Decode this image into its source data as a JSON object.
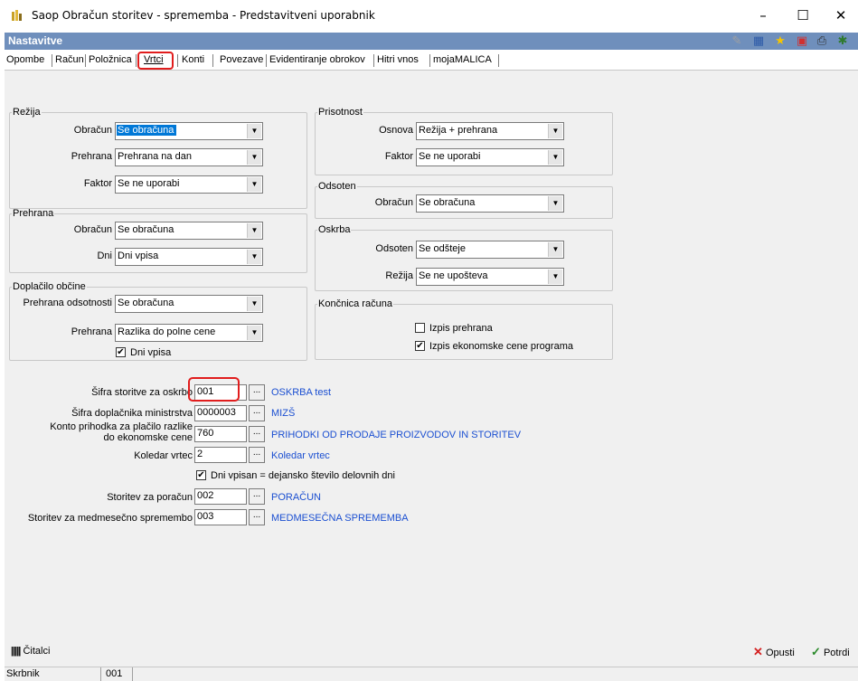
{
  "window": {
    "title": "Saop Obračun storitev - sprememba - Predstavitveni uporabnik",
    "minimize": "–",
    "maximize": "☐",
    "close": "✕"
  },
  "header": {
    "title": "Nastavitve",
    "icons": [
      "edit-icon",
      "grid-icon",
      "star-icon",
      "export-icon",
      "print-icon",
      "run-icon"
    ]
  },
  "tabs": [
    {
      "label": "Opombe"
    },
    {
      "label": "Račun"
    },
    {
      "label": "Položnica"
    },
    {
      "label": "Vrtci",
      "active": true
    },
    {
      "label": "Konti"
    },
    {
      "label": "Povezave"
    },
    {
      "label": "Evidentiranje obrokov"
    },
    {
      "label": "Hitri vnos"
    },
    {
      "label": "mojaMALICA"
    }
  ],
  "rezija": {
    "legend": "Režija",
    "obracun_label": "Obračun",
    "obracun_value": "Se obračuna",
    "prehrana_label": "Prehrana",
    "prehrana_value": "Prehrana na dan",
    "faktor_label": "Faktor",
    "faktor_value": "Se ne uporabi"
  },
  "prehrana": {
    "legend": "Prehrana",
    "obracun_label": "Obračun",
    "obracun_value": "Se obračuna",
    "dni_label": "Dni",
    "dni_value": "Dni vpisa"
  },
  "doplacilo": {
    "legend": "Doplačilo občine",
    "odsotnosti_label": "Prehrana odsotnosti",
    "odsotnosti_value": "Se obračuna",
    "prehrana_label": "Prehrana",
    "prehrana_value": "Razlika do polne cene",
    "dni_vpisa_label": "Dni vpisa",
    "dni_vpisa_checked": true
  },
  "prisotnost": {
    "legend": "Prisotnost",
    "osnova_label": "Osnova",
    "osnova_value": "Režija + prehrana",
    "faktor_label": "Faktor",
    "faktor_value": "Se ne uporabi"
  },
  "odsoten": {
    "legend": "Odsoten",
    "obracun_label": "Obračun",
    "obracun_value": "Se obračuna"
  },
  "oskrba": {
    "legend": "Oskrba",
    "odsoten_label": "Odsoten",
    "odsoten_value": "Se odšteje",
    "rezija_label": "Režija",
    "rezija_value": "Se ne upošteva"
  },
  "koncnica": {
    "legend": "Končnica računa",
    "izpis_prehrana_label": "Izpis prehrana",
    "izpis_prehrana_checked": false,
    "izpis_ekonomske_label": "Izpis ekonomske cene programa",
    "izpis_ekonomske_checked": true
  },
  "fields": {
    "sifra_storitve_label": "Šifra storitve za oskrbo",
    "sifra_storitve_value": "001",
    "sifra_storitve_desc": "OSKRBA test",
    "sifra_doplacnika_label": "Šifra doplačnika ministrstva",
    "sifra_doplacnika_value": "0000003",
    "sifra_doplacnika_desc": "MIZŠ",
    "konto_label_1": "Konto prihodka za plačilo razlike",
    "konto_label_2": "do ekonomske cene",
    "konto_value": "760",
    "konto_desc": "PRIHODKI OD PRODAJE PROIZVODOV IN STORITEV",
    "koledar_label": "Koledar vrtec",
    "koledar_value": "2",
    "koledar_desc": "Koledar vrtec",
    "dni_vpisan_label": "Dni vpisan = dejansko število delovnih dni",
    "dni_vpisan_checked": true,
    "poracun_label": "Storitev za poračun",
    "poracun_value": "002",
    "poracun_desc": "PORAČUN",
    "medmesecno_label": "Storitev za medmesečno spremembo",
    "medmesecno_value": "003",
    "medmesecno_desc": "MEDMESEČNA SPREMEMBA",
    "browse": "..."
  },
  "bottom": {
    "citalci_label": "Čitalci",
    "opusti_label": "Opusti",
    "potrdi_label": "Potrdi"
  },
  "status": {
    "left_label": "Skrbnik",
    "value": "001"
  },
  "colors": {
    "header_bg": "#6f8fbc",
    "link": "#1b4fd1",
    "highlight": "#e11d1d",
    "selection": "#0078d7"
  }
}
